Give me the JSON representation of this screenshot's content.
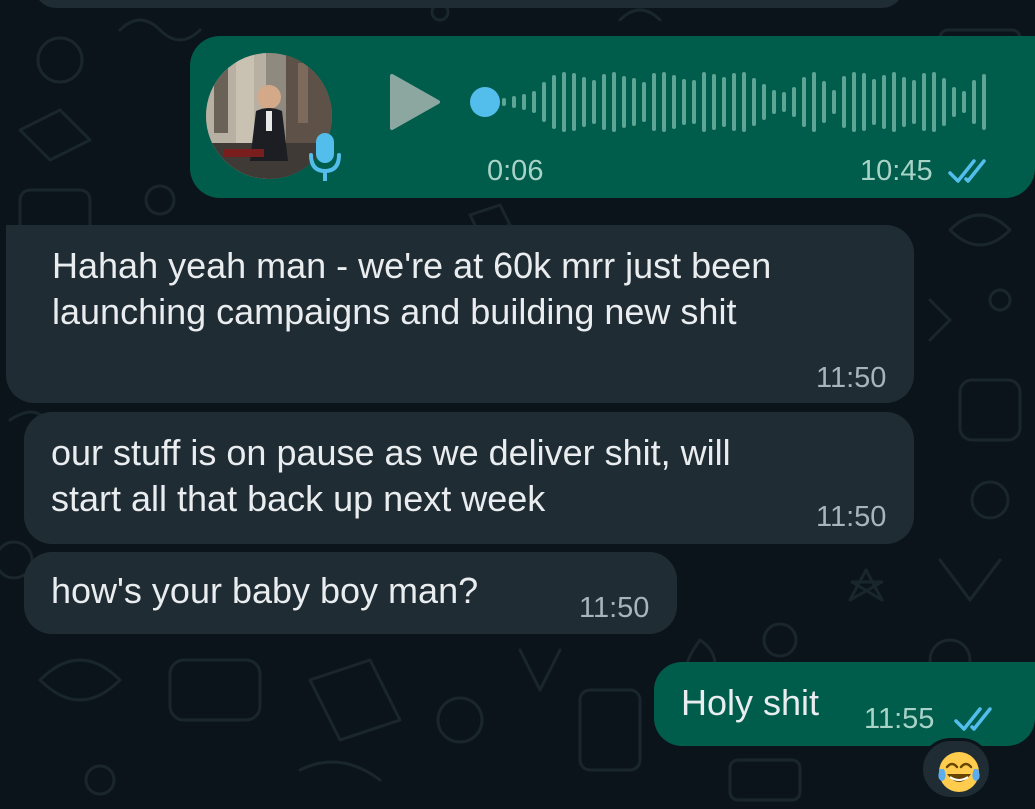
{
  "conversation": {
    "messages": [
      {
        "direction": "outgoing",
        "kind": "voice",
        "duration": "0:06",
        "time": "10:45",
        "status": "read"
      },
      {
        "direction": "incoming",
        "kind": "text",
        "text": "Hahah yeah man - we're at 60k mrr just been\nlaunching campaigns and building new shit",
        "time": "11:50"
      },
      {
        "direction": "incoming",
        "kind": "text",
        "text": "our stuff is on pause as we deliver shit, will\nstart all that back up next week",
        "time": "11:50"
      },
      {
        "direction": "incoming",
        "kind": "text",
        "text": "how's your baby boy man?",
        "time": "11:50"
      },
      {
        "direction": "outgoing",
        "kind": "text",
        "text": "Holy shit",
        "time": "11:55",
        "status": "read",
        "reaction": "face-with-tears-of-joy"
      }
    ]
  },
  "colors": {
    "background": "#0b141a",
    "incoming_bubble": "#202c33",
    "outgoing_bubble": "#005c4b",
    "read_ticks": "#53bdeb",
    "voice_dot": "#53bdeb"
  },
  "icons": {
    "play": "play-icon",
    "mic": "microphone-icon",
    "read_receipt": "double-check-icon",
    "reaction": "face-with-tears-of-joy-icon"
  }
}
